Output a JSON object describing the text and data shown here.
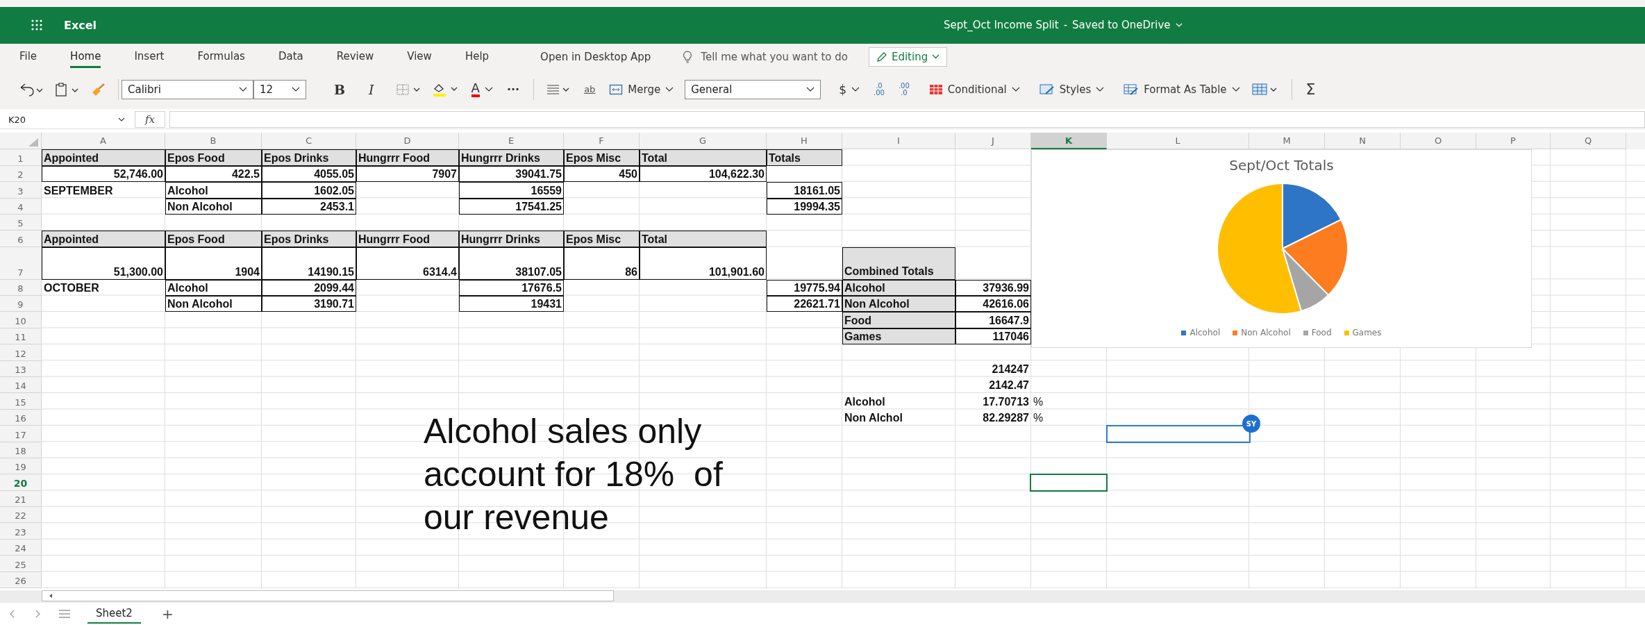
{
  "title_bar": {
    "app": "Excel",
    "document": "Sept_Oct Income Split",
    "separator": "-",
    "save_status": "Saved to OneDrive"
  },
  "ribbon_tabs": [
    {
      "label": "File",
      "selected": false
    },
    {
      "label": "Home",
      "selected": true
    },
    {
      "label": "Insert",
      "selected": false
    },
    {
      "label": "Formulas",
      "selected": false
    },
    {
      "label": "Data",
      "selected": false
    },
    {
      "label": "Review",
      "selected": false
    },
    {
      "label": "View",
      "selected": false
    },
    {
      "label": "Help",
      "selected": false
    }
  ],
  "open_desktop": "Open in Desktop App",
  "tell_me": "Tell me what you want to do",
  "mode_button": "Editing",
  "toolbar": {
    "font": "Calibri",
    "font_size": "12",
    "bold": "B",
    "italic": "I",
    "font_color": "A",
    "more": "···",
    "wrap": "ab",
    "merge": "Merge",
    "number_format": "General",
    "currency": "$",
    "decimals": [
      {
        "top": ".0",
        "bottom": ".00"
      },
      {
        "top": ".00",
        "bottom": ".0"
      }
    ],
    "conditional": "Conditional",
    "styles": "Styles",
    "format_as_table": "Format As Table",
    "sum": "Σ"
  },
  "formula_bar": {
    "name_box": "K20",
    "function_label": "fx"
  },
  "columns": [
    {
      "label": "A",
      "selected": false
    },
    {
      "label": "B",
      "selected": false
    },
    {
      "label": "C",
      "selected": false
    },
    {
      "label": "D",
      "selected": false
    },
    {
      "label": "E",
      "selected": false
    },
    {
      "label": "F",
      "selected": false
    },
    {
      "label": "G",
      "selected": false
    },
    {
      "label": "H",
      "selected": false
    },
    {
      "label": "I",
      "selected": false
    },
    {
      "label": "J",
      "selected": false
    },
    {
      "label": "K",
      "selected": true
    },
    {
      "label": "L",
      "selected": false
    },
    {
      "label": "M",
      "selected": false
    },
    {
      "label": "N",
      "selected": false
    },
    {
      "label": "O",
      "selected": false
    },
    {
      "label": "P",
      "selected": false
    },
    {
      "label": "Q",
      "selected": false
    }
  ],
  "rows": [
    {
      "number": "1",
      "selected": false,
      "tall": false,
      "cells": [
        {
          "kind": "heading",
          "text": "Appointed"
        },
        {
          "kind": "heading",
          "text": "Epos Food"
        },
        {
          "kind": "heading",
          "text": "Epos Drinks"
        },
        {
          "kind": "heading",
          "text": "Hungrrr Food"
        },
        {
          "kind": "heading",
          "text": "Hungrrr Drinks"
        },
        {
          "kind": "heading",
          "text": "Epos Misc"
        },
        {
          "kind": "heading",
          "text": "Total"
        },
        {
          "kind": "heading",
          "text": "Totals"
        }
      ]
    },
    {
      "number": "2",
      "selected": false,
      "tall": false,
      "cells": [
        {
          "kind": "number",
          "text": "52,746.00"
        },
        {
          "kind": "number",
          "text": "422.5"
        },
        {
          "kind": "number",
          "text": "4055.05"
        },
        {
          "kind": "number",
          "text": "7907"
        },
        {
          "kind": "number",
          "text": "39041.75"
        },
        {
          "kind": "number",
          "text": "450"
        },
        {
          "kind": "number",
          "text": "104,622.30"
        }
      ]
    },
    {
      "number": "3",
      "selected": false,
      "tall": false,
      "cells": [
        {
          "kind": "text",
          "text": "SEPTEMBER"
        },
        {
          "kind": "label",
          "text": "Alcohol"
        },
        {
          "kind": "number",
          "text": "1602.05"
        },
        {
          "kind": "empty"
        },
        {
          "kind": "number",
          "text": "16559"
        },
        {
          "kind": "empty"
        },
        {
          "kind": "empty"
        },
        {
          "kind": "number",
          "text": "18161.05"
        }
      ]
    },
    {
      "number": "4",
      "selected": false,
      "tall": false,
      "cells": [
        {
          "kind": "empty"
        },
        {
          "kind": "label",
          "text": "Non Alcohol"
        },
        {
          "kind": "number",
          "text": "2453.1"
        },
        {
          "kind": "empty"
        },
        {
          "kind": "number",
          "text": "17541.25"
        },
        {
          "kind": "empty"
        },
        {
          "kind": "empty"
        },
        {
          "kind": "number",
          "text": "19994.35"
        }
      ]
    },
    {
      "number": "5",
      "selected": false,
      "tall": false,
      "cells": []
    },
    {
      "number": "6",
      "selected": false,
      "tall": false,
      "cells": [
        {
          "kind": "heading",
          "text": "Appointed"
        },
        {
          "kind": "heading",
          "text": "Epos Food"
        },
        {
          "kind": "heading",
          "text": "Epos Drinks"
        },
        {
          "kind": "heading",
          "text": "Hungrrr Food"
        },
        {
          "kind": "heading",
          "text": "Hungrrr Drinks"
        },
        {
          "kind": "heading",
          "text": "Epos Misc"
        },
        {
          "kind": "heading",
          "text": "Total"
        }
      ]
    },
    {
      "number": "7",
      "selected": false,
      "tall": true,
      "cells": [
        {
          "kind": "number",
          "text": "51,300.00"
        },
        {
          "kind": "number",
          "text": "1904"
        },
        {
          "kind": "number",
          "text": "14190.15"
        },
        {
          "kind": "number",
          "text": "6314.4"
        },
        {
          "kind": "number",
          "text": "38107.05"
        },
        {
          "kind": "number",
          "text": "86"
        },
        {
          "kind": "number",
          "text": "101,901.60"
        },
        {
          "kind": "empty"
        },
        {
          "kind": "heading",
          "text": "Combined Totals"
        }
      ]
    },
    {
      "number": "8",
      "selected": false,
      "tall": false,
      "cells": [
        {
          "kind": "text",
          "text": "OCTOBER"
        },
        {
          "kind": "label",
          "text": "Alcohol"
        },
        {
          "kind": "number",
          "text": "2099.44"
        },
        {
          "kind": "empty"
        },
        {
          "kind": "number",
          "text": "17676.5"
        },
        {
          "kind": "empty"
        },
        {
          "kind": "empty"
        },
        {
          "kind": "number",
          "text": "19775.94"
        },
        {
          "kind": "heading",
          "text": "Alcohol"
        },
        {
          "kind": "number",
          "text": "37936.99"
        }
      ]
    },
    {
      "number": "9",
      "selected": false,
      "tall": false,
      "cells": [
        {
          "kind": "empty"
        },
        {
          "kind": "label",
          "text": "Non Alcohol"
        },
        {
          "kind": "number",
          "text": "3190.71"
        },
        {
          "kind": "empty"
        },
        {
          "kind": "number",
          "text": "19431"
        },
        {
          "kind": "empty"
        },
        {
          "kind": "empty"
        },
        {
          "kind": "number",
          "text": "22621.71"
        },
        {
          "kind": "heading",
          "text": "Non Alcohol"
        },
        {
          "kind": "number",
          "text": "42616.06"
        }
      ]
    },
    {
      "number": "10",
      "selected": false,
      "tall": false,
      "cells": [
        {
          "kind": "empty"
        },
        {
          "kind": "empty"
        },
        {
          "kind": "empty"
        },
        {
          "kind": "empty"
        },
        {
          "kind": "empty"
        },
        {
          "kind": "empty"
        },
        {
          "kind": "empty"
        },
        {
          "kind": "empty"
        },
        {
          "kind": "heading",
          "text": "Food"
        },
        {
          "kind": "number",
          "text": "16647.9"
        }
      ]
    },
    {
      "number": "11",
      "selected": false,
      "tall": false,
      "cells": [
        {
          "kind": "empty"
        },
        {
          "kind": "empty"
        },
        {
          "kind": "empty"
        },
        {
          "kind": "empty"
        },
        {
          "kind": "empty"
        },
        {
          "kind": "empty"
        },
        {
          "kind": "empty"
        },
        {
          "kind": "empty"
        },
        {
          "kind": "heading",
          "text": "Games"
        },
        {
          "kind": "number",
          "text": "117046"
        }
      ]
    },
    {
      "number": "12",
      "selected": false,
      "tall": false,
      "cells": []
    },
    {
      "number": "13",
      "selected": false,
      "tall": false,
      "cells": [
        {
          "kind": "empty"
        },
        {
          "kind": "empty"
        },
        {
          "kind": "empty"
        },
        {
          "kind": "empty"
        },
        {
          "kind": "empty"
        },
        {
          "kind": "empty"
        },
        {
          "kind": "empty"
        },
        {
          "kind": "empty"
        },
        {
          "kind": "empty"
        },
        {
          "kind": "value",
          "text": "214247"
        }
      ]
    },
    {
      "number": "14",
      "selected": false,
      "tall": false,
      "cells": [
        {
          "kind": "empty"
        },
        {
          "kind": "empty"
        },
        {
          "kind": "empty"
        },
        {
          "kind": "empty"
        },
        {
          "kind": "empty"
        },
        {
          "kind": "empty"
        },
        {
          "kind": "empty"
        },
        {
          "kind": "empty"
        },
        {
          "kind": "empty"
        },
        {
          "kind": "value",
          "text": "2142.47"
        }
      ]
    },
    {
      "number": "15",
      "selected": false,
      "tall": false,
      "cells": [
        {
          "kind": "empty"
        },
        {
          "kind": "empty"
        },
        {
          "kind": "empty"
        },
        {
          "kind": "empty"
        },
        {
          "kind": "empty"
        },
        {
          "kind": "empty"
        },
        {
          "kind": "empty"
        },
        {
          "kind": "empty"
        },
        {
          "kind": "text",
          "text": "Alcohol"
        },
        {
          "kind": "value",
          "text": "17.70713"
        },
        {
          "kind": "note",
          "text": "%"
        }
      ]
    },
    {
      "number": "16",
      "selected": false,
      "tall": false,
      "cells": [
        {
          "kind": "empty"
        },
        {
          "kind": "empty"
        },
        {
          "kind": "empty"
        },
        {
          "kind": "empty"
        },
        {
          "kind": "empty"
        },
        {
          "kind": "empty"
        },
        {
          "kind": "empty"
        },
        {
          "kind": "empty"
        },
        {
          "kind": "text",
          "text": "Non Alchol"
        },
        {
          "kind": "value",
          "text": "82.29287"
        },
        {
          "kind": "note",
          "text": "%"
        }
      ]
    },
    {
      "number": "17",
      "selected": false,
      "tall": false,
      "cells": [
        {
          "kind": "empty"
        },
        {
          "kind": "empty"
        },
        {
          "kind": "empty"
        },
        {
          "kind": "empty"
        },
        {
          "kind": "empty"
        },
        {
          "kind": "empty"
        },
        {
          "kind": "empty"
        },
        {
          "kind": "empty"
        },
        {
          "kind": "empty"
        },
        {
          "kind": "empty"
        },
        {
          "kind": "empty"
        },
        {
          "kind": "collaborator",
          "badge": "SY"
        }
      ]
    },
    {
      "number": "18",
      "selected": false,
      "tall": false,
      "cells": []
    },
    {
      "number": "19",
      "selected": false,
      "tall": false,
      "cells": []
    },
    {
      "number": "20",
      "selected": true,
      "tall": false,
      "cells": [
        {
          "kind": "empty"
        },
        {
          "kind": "empty"
        },
        {
          "kind": "empty"
        },
        {
          "kind": "empty"
        },
        {
          "kind": "empty"
        },
        {
          "kind": "empty"
        },
        {
          "kind": "empty"
        },
        {
          "kind": "empty"
        },
        {
          "kind": "empty"
        },
        {
          "kind": "empty"
        },
        {
          "kind": "active"
        }
      ]
    },
    {
      "number": "21",
      "selected": false,
      "tall": false,
      "cells": []
    },
    {
      "number": "22",
      "selected": false,
      "tall": false,
      "cells": []
    },
    {
      "number": "23",
      "selected": false,
      "tall": false,
      "cells": []
    },
    {
      "number": "24",
      "selected": false,
      "tall": false,
      "cells": []
    },
    {
      "number": "25",
      "selected": false,
      "tall": false,
      "cells": []
    },
    {
      "number": "26",
      "selected": false,
      "tall": false,
      "cells": []
    }
  ],
  "text_box": "Alcohol sales only account for 18%  of our revenue",
  "chart": {
    "chart_data": {
      "type": "pie",
      "title": "Sept/Oct Totals",
      "categories": [
        "Alcohol",
        "Non Alcohol",
        "Food",
        "Games"
      ],
      "legend": "bottom",
      "series": [
        {
          "colors": [
            "#2e75c6",
            "#fd7c1f",
            "#a5a5a5",
            "#ffbe00"
          ],
          "values": [
            17.707,
            19.891,
            7.77,
            54.632
          ]
        }
      ]
    }
  },
  "sheet_tabs": [
    {
      "label": "Sheet2",
      "selected": true
    }
  ],
  "add_sheet": "+"
}
